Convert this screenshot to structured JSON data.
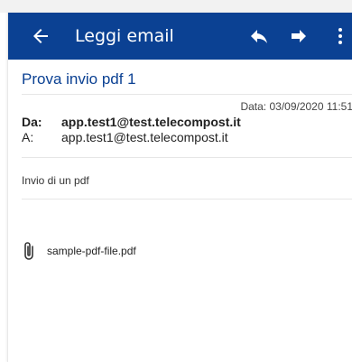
{
  "appbar": {
    "title": "Leggi email",
    "back_icon": "arrow-left-icon",
    "reply_icon": "reply-icon",
    "forward_icon": "forward-icon",
    "more_icon": "more-vert-icon",
    "background": "#0b4193"
  },
  "email": {
    "subject": "Prova invio pdf 1",
    "date": "Data: 03/09/2020 11:51",
    "from_label": "Da:",
    "from": "app.test1@test.telecompost.it",
    "to_label": "A:",
    "to": "app.test1@test.telecompost.it",
    "body": "Invio di un pdf",
    "attachments": [
      {
        "name": "sample-pdf-file.pdf",
        "icon": "paperclip-icon"
      }
    ]
  },
  "colors": {
    "accent": "#0b4193"
  }
}
